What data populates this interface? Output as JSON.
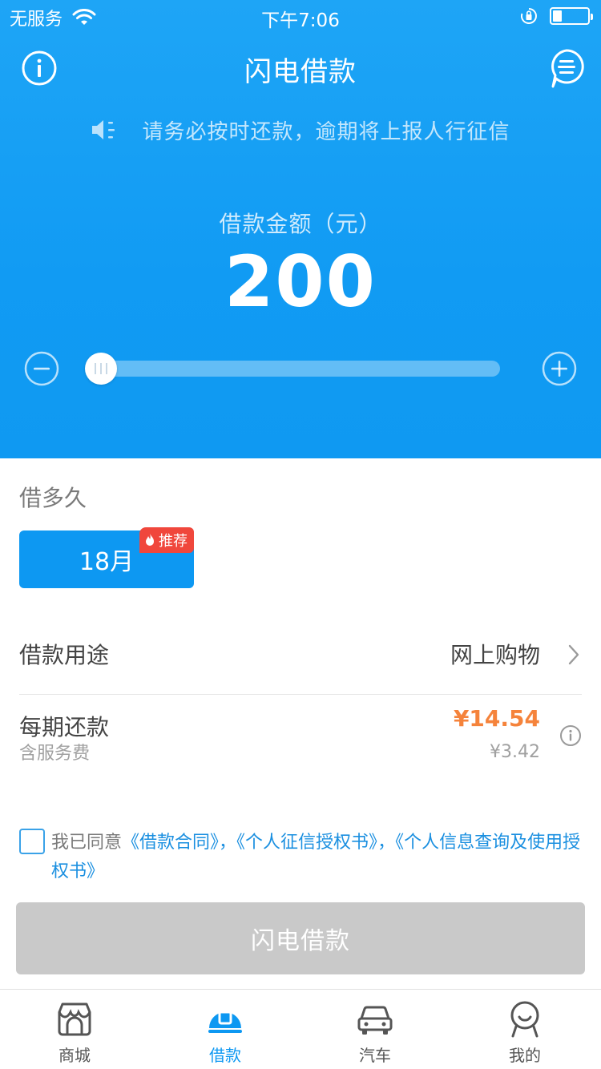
{
  "status_bar": {
    "carrier": "无服务",
    "time": "下午7:06",
    "battery_percent": 25
  },
  "nav": {
    "title": "闪电借款",
    "left_icon": "info-icon",
    "right_icon": "chat-menu-icon"
  },
  "notice": {
    "icon": "speaker-icon",
    "text": "请务必按时还款，逾期将上报人行征信"
  },
  "loan": {
    "amount_label": "借款金额（元）",
    "amount": "200",
    "slider_fraction": 0.0
  },
  "term": {
    "section_label": "借多久",
    "selected": "18月",
    "badge": "推荐"
  },
  "purpose": {
    "label": "借款用途",
    "value": "网上购物"
  },
  "installment": {
    "label": "每期还款",
    "sub_label": "含服务费",
    "amount": "¥14.54",
    "fee": "¥3.42"
  },
  "agreement": {
    "prefix": "我已同意",
    "link1": "《借款合同》",
    "sep1": "，",
    "link2": "《个人征信授权书》",
    "sep2": "，",
    "link3": "《个人信息查询及使用授权书》"
  },
  "submit_label": "闪电借款",
  "tabs": [
    {
      "label": "商城",
      "icon": "store-icon",
      "active": false
    },
    {
      "label": "借款",
      "icon": "loan-icon",
      "active": true
    },
    {
      "label": "汽车",
      "icon": "car-icon",
      "active": false
    },
    {
      "label": "我的",
      "icon": "profile-icon",
      "active": false
    }
  ],
  "colors": {
    "primary": "#0d98f2",
    "accent_orange": "#f5833b",
    "badge_red": "#f0473c",
    "disabled_button": "#c9c9c9"
  }
}
